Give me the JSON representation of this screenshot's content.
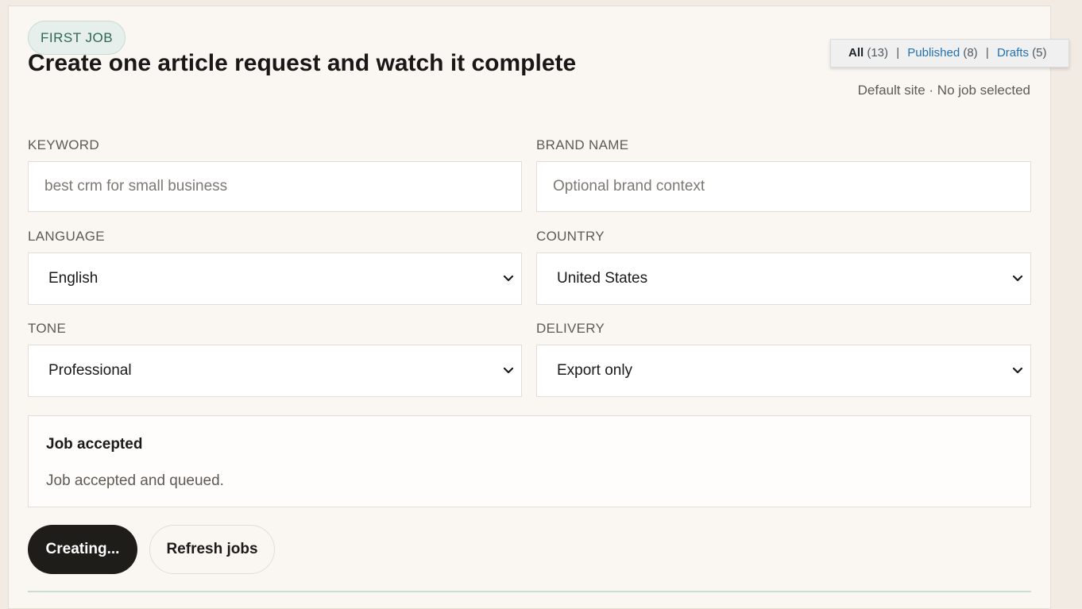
{
  "badge": "FIRST JOB",
  "title": "Create one article request and watch it complete",
  "meta": "Default site · No job selected",
  "filters": {
    "all": {
      "label": "All",
      "count": "(13)"
    },
    "published": {
      "label": "Published",
      "count": "(8)"
    },
    "drafts": {
      "label": "Drafts",
      "count": "(5)"
    },
    "separator": "|"
  },
  "form": {
    "keyword": {
      "label": "KEYWORD",
      "placeholder": "best crm for small business"
    },
    "brand": {
      "label": "BRAND NAME",
      "placeholder": "Optional brand context"
    },
    "language": {
      "label": "LANGUAGE",
      "value": "English"
    },
    "country": {
      "label": "COUNTRY",
      "value": "United States"
    },
    "tone": {
      "label": "TONE",
      "value": "Professional"
    },
    "delivery": {
      "label": "DELIVERY",
      "value": "Export only"
    }
  },
  "status": {
    "title": "Job accepted",
    "message": "Job accepted and queued."
  },
  "buttons": {
    "create": "Creating...",
    "refresh": "Refresh jobs"
  },
  "icons": {
    "select_arrow": "chevron-down-icon"
  },
  "colors": {
    "page_bg": "#f1ebe3",
    "panel_bg": "#faf7f3",
    "badge_bg": "#e6efeb",
    "badge_text": "#2f6656",
    "link": "#2271b1",
    "primary_button": "#1f1d1a"
  }
}
